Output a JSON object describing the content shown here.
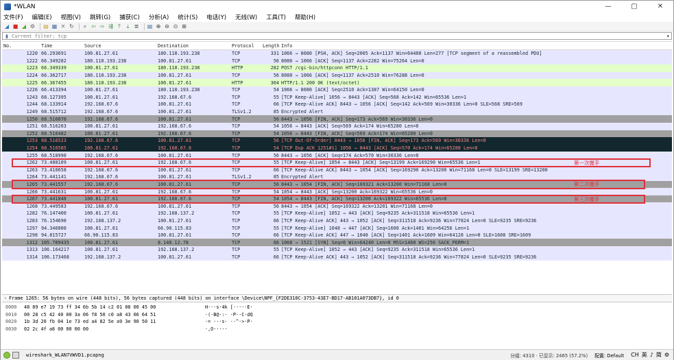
{
  "window": {
    "title": "*WLAN",
    "minimize": "—",
    "maximize": "▢",
    "close": "✕"
  },
  "menu": [
    "文件(F)",
    "编辑(E)",
    "视图(V)",
    "跳转(G)",
    "捕获(C)",
    "分析(A)",
    "统计(S)",
    "电话(Y)",
    "无线(W)",
    "工具(T)",
    "帮助(H)"
  ],
  "toolbar_icons": [
    "shark-fin-start-icon",
    "stop-capture-icon",
    "restart-capture-icon",
    "capture-options-icon",
    "open-file-icon",
    "save-file-icon",
    "close-file-icon",
    "reload-icon",
    "find-packet-icon",
    "go-back-icon",
    "go-forward-icon",
    "go-to-packet-icon",
    "first-packet-icon",
    "last-packet-icon",
    "autoscroll-icon",
    "colorize-icon",
    "zoom-in-icon",
    "zoom-out-icon",
    "normal-size-icon",
    "resize-columns-icon"
  ],
  "filter": {
    "placeholder": "Current filter: tcp",
    "value": ""
  },
  "columns": {
    "no": "No.",
    "time": "Time",
    "source": "Source",
    "destination": "Destination",
    "protocol": "Protocol",
    "length": "Length",
    "info": "Info"
  },
  "packets": [
    {
      "no": "1220",
      "time": "66.293691",
      "src": "100.81.27.61",
      "dst": "180.110.193.238",
      "proto": "TCP",
      "len": "331",
      "info": "1066 → 8080 [PSH, ACK] Seq=2005 Ack=1137 Win=64400 Len=277 [TCP segment of a reassembled PDU]",
      "color": "lilac"
    },
    {
      "no": "1222",
      "time": "66.349282",
      "src": "180.110.193.238",
      "dst": "100.81.27.61",
      "proto": "TCP",
      "len": "56",
      "info": "8080 → 1066 [ACK] Seq=1137 Ack=2282 Win=75264 Len=0",
      "color": "lilac"
    },
    {
      "no": "1223",
      "time": "66.349339",
      "src": "100.81.27.61",
      "dst": "180.110.193.238",
      "proto": "HTTP",
      "len": "282",
      "info": "POST /cgi-bin/httpconn HTTP/1.1",
      "color": "green"
    },
    {
      "no": "1224",
      "time": "66.362717",
      "src": "180.110.193.238",
      "dst": "100.81.27.61",
      "proto": "TCP",
      "len": "56",
      "info": "8080 → 1066 [ACK] Seq=1137 Ack=2510 Win=76288 Len=0",
      "color": "lilac"
    },
    {
      "no": "1225",
      "time": "66.367455",
      "src": "180.110.193.238",
      "dst": "100.81.27.61",
      "proto": "HTTP",
      "len": "304",
      "info": "HTTP/1.1 200 OK  (text/octet)",
      "color": "green"
    },
    {
      "no": "1226",
      "time": "66.413394",
      "src": "100.81.27.61",
      "dst": "180.110.193.238",
      "proto": "TCP",
      "len": "54",
      "info": "1066 → 8080 [ACK] Seq=2510 Ack=1387 Win=64150 Len=0",
      "color": "lilac"
    },
    {
      "no": "1243",
      "time": "68.127395",
      "src": "100.81.27.61",
      "dst": "192.168.67.6",
      "proto": "TCP",
      "len": "55",
      "info": "[TCP Keep-Alive] 1056 → 8443 [ACK] Seq=568 Ack=142 Win=65536 Len=1",
      "color": "lilac"
    },
    {
      "no": "1244",
      "time": "68.133914",
      "src": "192.168.67.6",
      "dst": "100.81.27.61",
      "proto": "TCP",
      "len": "66",
      "info": "[TCP Keep-Alive ACK] 8443 → 1056 [ACK] Seq=142 Ack=569 Win=30336 Len=0 SLE=568 SRE=569",
      "color": "lilac"
    },
    {
      "no": "1249",
      "time": "68.515712",
      "src": "192.168.67.6",
      "dst": "100.81.27.61",
      "proto": "TLSv1.2",
      "len": "85",
      "info": "Encrypted Alert",
      "color": "lilac"
    },
    {
      "no": "1250",
      "time": "68.516070",
      "src": "192.168.67.6",
      "dst": "100.81.27.61",
      "proto": "TCP",
      "len": "56",
      "info": "8443 → 1056 [FIN, ACK] Seq=173 Ack=569 Win=30336 Len=0",
      "color": "gray"
    },
    {
      "no": "1251",
      "time": "68.516203",
      "src": "100.81.27.61",
      "dst": "192.168.67.6",
      "proto": "TCP",
      "len": "54",
      "info": "1056 → 8443 [ACK] Seq=569 Ack=174 Win=65280 Len=0",
      "color": "lilac"
    },
    {
      "no": "1252",
      "time": "68.516482",
      "src": "100.81.27.61",
      "dst": "192.168.67.6",
      "proto": "TCP",
      "len": "54",
      "info": "1056 → 8443 [FIN, ACK] Seq=569 Ack=174 Win=65280 Len=0",
      "color": "gray"
    },
    {
      "no": "1253",
      "time": "68.516523",
      "src": "192.168.67.6",
      "dst": "100.81.27.61",
      "proto": "TCP",
      "len": "56",
      "info": "[TCP Out-Of-Order] 8443 → 1056 [FIN, ACK] Seq=173 Ack=569 Win=30336 Len=0",
      "color": "black"
    },
    {
      "no": "1254",
      "time": "68.516585",
      "src": "100.81.27.61",
      "dst": "192.168.67.6",
      "proto": "TCP",
      "len": "54",
      "info": "[TCP Dup ACK 1251#1] 1056 → 8443 [ACK] Seq=570 Ack=174 Win=65280 Len=0",
      "color": "black"
    },
    {
      "no": "1255",
      "time": "68.518990",
      "src": "192.168.67.6",
      "dst": "100.81.27.61",
      "proto": "TCP",
      "len": "56",
      "info": "8443 → 1056 [ACK] Seq=174 Ack=570 Win=30336 Len=0",
      "color": "lilac"
    },
    {
      "no": "1262",
      "time": "73.408109",
      "src": "100.81.27.61",
      "dst": "192.168.67.6",
      "proto": "TCP",
      "len": "55",
      "info": "[TCP Keep-Alive] 1054 → 8443 [ACK] Seq=13199 Ack=169290 Win=65536 Len=1",
      "color": "lilac"
    },
    {
      "no": "1263",
      "time": "73.410658",
      "src": "192.168.67.6",
      "dst": "100.81.27.61",
      "proto": "TCP",
      "len": "66",
      "info": "[TCP Keep-Alive ACK] 8443 → 1054 [ACK] Seq=169290 Ack=13200 Win=71168 Len=0 SLE=13199 SRE=13200",
      "color": "lilac"
    },
    {
      "no": "1264",
      "time": "73.441141",
      "src": "192.168.67.6",
      "dst": "100.81.27.61",
      "proto": "TLSv1.2",
      "len": "85",
      "info": "Encrypted Alert",
      "color": "lilac"
    },
    {
      "no": "1265",
      "time": "73.441557",
      "src": "192.168.67.6",
      "dst": "100.81.27.61",
      "proto": "TCP",
      "len": "56",
      "info": "8443 → 1054 [FIN, ACK] Seq=169321 Ack=13200 Win=71168 Len=0",
      "color": "gray"
    },
    {
      "no": "1266",
      "time": "73.441631",
      "src": "100.81.27.61",
      "dst": "192.168.67.6",
      "proto": "TCP",
      "len": "54",
      "info": "1054 → 8443 [ACK] Seq=13200 Ack=169322 Win=65536 Len=0",
      "color": "lilac"
    },
    {
      "no": "1267",
      "time": "73.441848",
      "src": "100.81.27.61",
      "dst": "192.168.67.6",
      "proto": "TCP",
      "len": "54",
      "info": "1054 → 8443 [FIN, ACK] Seq=13200 Ack=169322 Win=65536 Len=0",
      "color": "gray"
    },
    {
      "no": "1268",
      "time": "73.449583",
      "src": "192.168.67.6",
      "dst": "100.81.27.61",
      "proto": "TCP",
      "len": "56",
      "info": "8443 → 1054 [ACK] Seq=169322 Ack=13201 Win=71168 Len=0",
      "color": "lilac"
    },
    {
      "no": "1282",
      "time": "76.147400",
      "src": "100.81.27.61",
      "dst": "192.168.137.2",
      "proto": "TCP",
      "len": "55",
      "info": "[TCP Keep-Alive] 1052 → 443 [ACK] Seq=9235 Ack=311518 Win=65536 Len=1",
      "color": "lilac"
    },
    {
      "no": "1283",
      "time": "76.154690",
      "src": "192.168.137.2",
      "dst": "100.81.27.61",
      "proto": "TCP",
      "len": "66",
      "info": "[TCP Keep-Alive ACK] 443 → 1052 [ACK] Seq=311518 Ack=9236 Win=77824 Len=0 SLE=9235 SRE=9236",
      "color": "lilac"
    },
    {
      "no": "1297",
      "time": "94.346000",
      "src": "100.81.27.61",
      "dst": "66.90.115.83",
      "proto": "TCP",
      "len": "55",
      "info": "[TCP Keep-Alive] 1048 → 447 [ACK] Seq=1608 Ack=1401 Win=64256 Len=1",
      "color": "lilac"
    },
    {
      "no": "1298",
      "time": "94.815727",
      "src": "66.90.115.83",
      "dst": "100.81.27.61",
      "proto": "TCP",
      "len": "66",
      "info": "[TCP Keep-Alive ACK] 447 → 1048 [ACK] Seq=1401 Ack=1609 Win=64128 Len=0 SLE=1608 SRE=1609",
      "color": "lilac"
    },
    {
      "no": "1312",
      "time": "105.709435",
      "src": "100.81.27.61",
      "dst": "8.140.12.78",
      "proto": "TCP",
      "len": "66",
      "info": "1068 → 1521 [SYN] Seq=0 Win=64240 Len=0 MSS=1460 WS=256 SACK_PERM=1",
      "color": "gray"
    },
    {
      "no": "1313",
      "time": "106.164217",
      "src": "100.81.27.61",
      "dst": "192.168.137.2",
      "proto": "TCP",
      "len": "55",
      "info": "[TCP Keep-Alive] 1052 → 443 [ACK] Seq=9235 Ack=311518 Win=65536 Len=1",
      "color": "lilac"
    },
    {
      "no": "1314",
      "time": "106.173468",
      "src": "192.168.137.2",
      "dst": "100.81.27.61",
      "proto": "TCP",
      "len": "66",
      "info": "[TCP Keep-Alive ACK] 443 → 1052 [ACK] Seq=311518 Ack=9236 Win=77824 Len=0 SLE=9235 SRE=9236",
      "color": "lilac"
    }
  ],
  "annotations": [
    {
      "row": "1262",
      "label": "第一次握手"
    },
    {
      "row": "1265",
      "label": "第二次握手"
    },
    {
      "row": "1267",
      "label": "第三次握手"
    }
  ],
  "detail": {
    "arrow": "›",
    "text": "Frame 1265: 56 bytes on wire (448 bits), 56 bytes captured (448 bits) on interface \\Device\\NPF_{F2DE310C-3753-43E7-BD17-AB101A073DB7}, id 0"
  },
  "hex": [
    {
      "offset": "0000",
      "bytes": "48 89 e7 19 73 ff 34 6b  5b 14 c2 01 08 00 45 00",
      "ascii": "H···s·4k [·····E·"
    },
    {
      "offset": "0010",
      "bytes": "00 28 c5 42 40 00 3a 06  f8 50 c0 a8 43 06 64 51",
      "ascii": "·(·B@·:· ·P··C·dQ"
    },
    {
      "offset": "0020",
      "bytes": "1b 3d 20 fb 04 1e 73 ed  a4 82 5e a9 3e 90 50 11",
      "ascii": "·= ···s· ··^·>·P·"
    },
    {
      "offset": "0030",
      "bytes": "02 2c 4f a8 00 00 00 00",
      "ascii": "·,O·····"
    }
  ],
  "status": {
    "file": "wireshark_WLAN7VWVD1.pcapng",
    "stats": "分组: 4310 · 已显示: 2465 (57.2%)",
    "profile": "配置: Default",
    "ime": [
      "CH",
      "英",
      "♪",
      "简",
      "⚙"
    ]
  }
}
